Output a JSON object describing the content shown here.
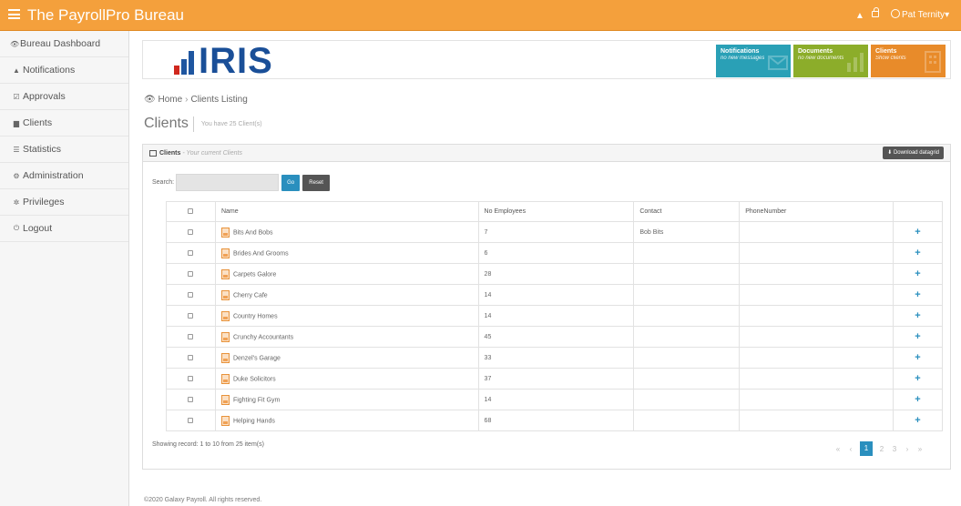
{
  "app": {
    "title": "The PayrollPro Bureau"
  },
  "topbar": {
    "user_name": "Pat Ternity",
    "user_caret": "▾",
    "bell_glyph": "▲"
  },
  "sidebar": {
    "items": [
      {
        "label": "Bureau Dashboard",
        "icon": "eye-icon",
        "glyph": "👁"
      },
      {
        "label": "Notifications",
        "icon": "bell-icon",
        "glyph": "▲"
      },
      {
        "label": "Approvals",
        "icon": "checkbox-icon",
        "glyph": "☑"
      },
      {
        "label": "Clients",
        "icon": "building-icon",
        "glyph": "▆"
      },
      {
        "label": "Statistics",
        "icon": "database-icon",
        "glyph": "☰"
      },
      {
        "label": "Administration",
        "icon": "gears-icon",
        "glyph": "⚙"
      },
      {
        "label": "Privileges",
        "icon": "users-icon",
        "glyph": "✲"
      },
      {
        "label": "Logout",
        "icon": "power-icon",
        "glyph": "⏻"
      }
    ]
  },
  "banner": {
    "logo_text": "IRIS",
    "tiles": [
      {
        "title": "Notifications",
        "subtitle": "no new messages",
        "color": "#2aa0b6"
      },
      {
        "title": "Documents",
        "subtitle": "no new documents",
        "color": "#8cad2a"
      },
      {
        "title": "Clients",
        "subtitle": "Show clients",
        "color": "#e88b2a"
      }
    ]
  },
  "breadcrumb": {
    "home": "Home",
    "separator": "›",
    "current": "Clients Listing"
  },
  "page": {
    "title": "Clients",
    "subtitle": "You have 25 Client(s)"
  },
  "panel": {
    "title": "Clients",
    "subtitle": "- Your current Clients",
    "download_label": "Download datagrid"
  },
  "search": {
    "label": "Search:",
    "value": "",
    "go_label": "Go",
    "reset_label": "Reset"
  },
  "table": {
    "headers": [
      "",
      "Name",
      "No Employees",
      "Contact",
      "PhoneNumber",
      ""
    ],
    "rows": [
      {
        "name": "Bits And Bobs",
        "employees": "7",
        "contact": "Bob Bits",
        "phone": ""
      },
      {
        "name": "Brides And Grooms",
        "employees": "6",
        "contact": "",
        "phone": ""
      },
      {
        "name": "Carpets Galore",
        "employees": "28",
        "contact": "",
        "phone": ""
      },
      {
        "name": "Cherry Cafe",
        "employees": "14",
        "contact": "",
        "phone": ""
      },
      {
        "name": "Country Homes",
        "employees": "14",
        "contact": "",
        "phone": ""
      },
      {
        "name": "Crunchy Accountants",
        "employees": "45",
        "contact": "",
        "phone": ""
      },
      {
        "name": "Denzel's Garage",
        "employees": "33",
        "contact": "",
        "phone": ""
      },
      {
        "name": "Duke Solicitors",
        "employees": "37",
        "contact": "",
        "phone": ""
      },
      {
        "name": "Fighting Fit Gym",
        "employees": "14",
        "contact": "",
        "phone": ""
      },
      {
        "name": "Helping Hands",
        "employees": "68",
        "contact": "",
        "phone": ""
      }
    ],
    "action_glyph": "+"
  },
  "pagination": {
    "status": "Showing record: 1 to 10 from 25 item(s)",
    "first": "«",
    "prev": "‹",
    "pages": [
      "1",
      "2",
      "3"
    ],
    "current_page": "1",
    "next": "›",
    "last": "»"
  },
  "footer": {
    "copyright": "©2020 Galaxy Payroll. All rights reserved."
  }
}
